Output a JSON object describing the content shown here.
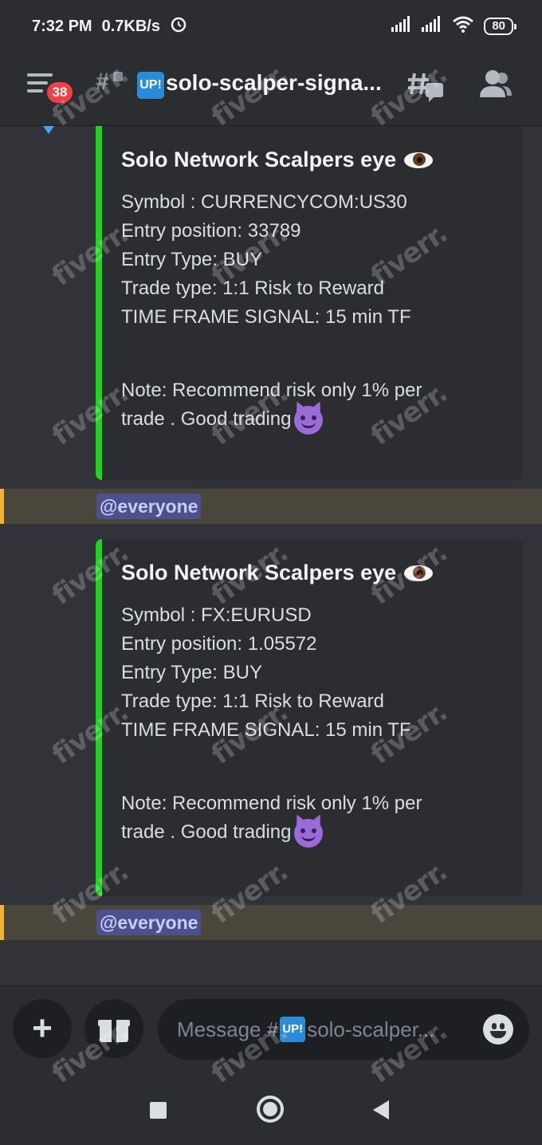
{
  "status_bar": {
    "time": "7:32 PM",
    "speed": "0.7KB/s",
    "alarm_icon": "alarm-icon",
    "signal_icons": [
      "signal-icon",
      "signal-icon"
    ],
    "wifi_icon": "wifi-icon",
    "battery": "80"
  },
  "header": {
    "menu_badge": "38",
    "channel_tag": "UP!",
    "channel_name": "solo-scalper-signa..."
  },
  "messages": [
    {
      "title": "Solo Network Scalpers eye",
      "fields": [
        "Symbol : CURRENCYCOM:US30",
        "Entry position: 33789",
        "Entry Type: BUY",
        "Trade type: 1:1 Risk to Reward",
        "TIME FRAME SIGNAL: 15 min TF"
      ],
      "note_line1": "Note: Recommend risk only 1% per",
      "note_line2": "trade . Good trading",
      "mention": "@everyone"
    },
    {
      "title": "Solo Network Scalpers eye",
      "fields": [
        "Symbol : FX:EURUSD",
        "Entry position: 1.05572",
        "Entry Type: BUY",
        "Trade type: 1:1 Risk to Reward",
        "TIME FRAME SIGNAL: 15 min TF"
      ],
      "note_line1": "Note: Recommend risk only 1% per",
      "note_line2": "trade . Good trading",
      "mention": "@everyone"
    }
  ],
  "composer": {
    "placeholder_prefix": "Message #",
    "channel_tag": "UP!",
    "placeholder_suffix": "solo-scalper..."
  },
  "watermark": "fiverr.",
  "colors": {
    "embed_border": "#1dd51d",
    "mention_highlight": "#f0b232",
    "badge": "#f23f43"
  }
}
